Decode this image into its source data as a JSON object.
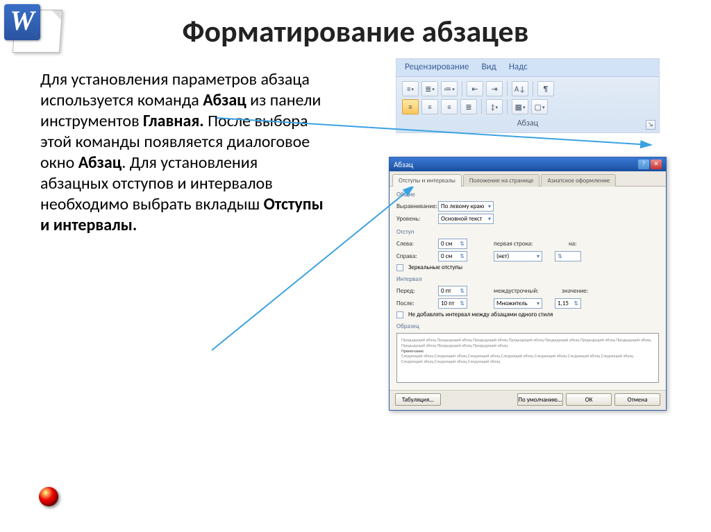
{
  "title": "Форматирование абзацев",
  "body_html": "Для установления параметров абзаца используется команда <b>Абзац</b> из панели инструментов <b>Главная.</b> После выбора этой команды появляется диалоговое окно <b>Абзац</b>. Для установления абзацных отступов и интервалов необходимо выбрать вкладыш <b>Отступы и интервалы.</b>",
  "ribbon": {
    "tabs": [
      "Рецензирование",
      "Вид",
      "Надс"
    ],
    "group_label": "Абзац"
  },
  "dialog": {
    "title": "Абзац",
    "tabs": [
      "Отступы и интервалы",
      "Положение на странице",
      "Азиатское оформление"
    ],
    "sections": {
      "general": {
        "title": "Общие",
        "align_label": "Выравнивание:",
        "align_value": "По левому краю",
        "level_label": "Уровень:",
        "level_value": "Основной текст"
      },
      "indent": {
        "title": "Отступ",
        "left_label": "Слева:",
        "left_value": "0 см",
        "right_label": "Справа:",
        "right_value": "0 см",
        "first_label": "первая строка:",
        "first_value": "(нет)",
        "by_label": "на:",
        "mirror": "Зеркальные отступы"
      },
      "spacing": {
        "title": "Интервал",
        "before_label": "Перед:",
        "before_value": "0 пт",
        "after_label": "После:",
        "after_value": "10 пт",
        "line_label": "междустрочный:",
        "line_value": "Множитель",
        "val_label": "значение:",
        "val_value": "1,15",
        "nosame": "Не добавлять интервал между абзацами одного стиля"
      },
      "preview": {
        "title": "Образец",
        "sample_light": "Предыдущий абзац Предыдущий абзац Предыдущий абзац Предыдущий абзац Предыдущий абзац Предыдущий абзац Предыдущий абзац Предыдущий абзац Предыдущий абзац Предыдущий абзац",
        "sample_dark": "Примечание",
        "sample_light2": "Следующий абзац Следующий абзац Следующий абзац Следующий абзац Следующий абзац Следующий абзац Следующий абзац Следующий абзац Следующий абзац Следующий абзац"
      }
    },
    "buttons": {
      "tabs": "Табуляция...",
      "default": "По умолчанию...",
      "ok": "ОК",
      "cancel": "Отмена"
    }
  }
}
